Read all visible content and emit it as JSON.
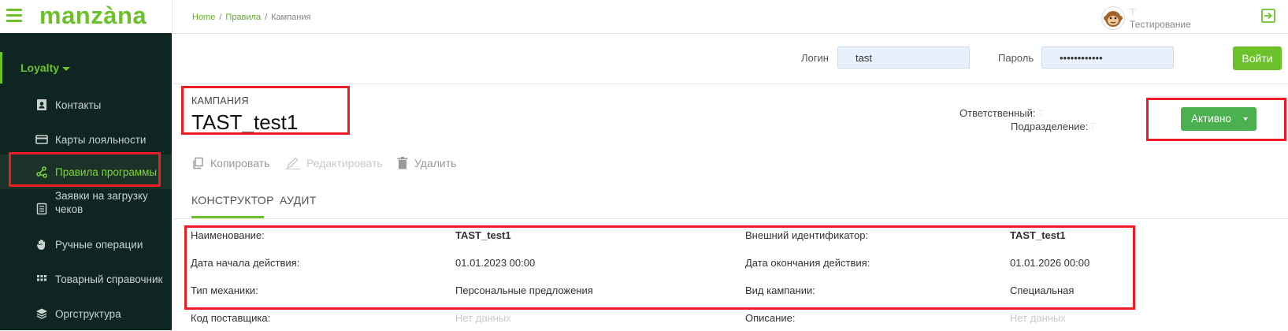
{
  "brand": {
    "logo": "manzàna"
  },
  "sidebar": {
    "section": "Loyalty",
    "items": [
      {
        "label": "Контакты",
        "icon": "contact-card-icon"
      },
      {
        "label": "Карты лояльности",
        "icon": "credit-card-icon"
      },
      {
        "label": "Правила программы",
        "icon": "share-nodes-icon",
        "active": true
      },
      {
        "label": "Заявки на загрузку чеков",
        "icon": "receipt-list-icon"
      },
      {
        "label": "Ручные операции",
        "icon": "hand-icon"
      },
      {
        "label": "Товарный справочник",
        "icon": "grid-icon"
      },
      {
        "label": "Оргструктура",
        "icon": "layers-icon"
      }
    ]
  },
  "breadcrumb": {
    "home": "Home",
    "rules": "Правила",
    "current": "Кампания",
    "sep": "/"
  },
  "user": {
    "name": "Т",
    "org": "Тестирование"
  },
  "login": {
    "login_label": "Логин",
    "login_value": "tast",
    "password_label": "Пароль",
    "password_value": "••••••••••••",
    "submit_label": "Войти"
  },
  "campaign": {
    "kicker": "КАМПАНИЯ",
    "title": "TAST_test1",
    "responsible_label": "Ответственный:",
    "responsible_value": "Т",
    "department_label": "Подразделение:",
    "department_value": "Т",
    "status_label": "Активно"
  },
  "actions": {
    "copy": "Копировать",
    "edit": "Редактировать",
    "delete": "Удалить"
  },
  "tabs": {
    "constructor": "КОНСТРУКТОР",
    "audit": "АУДИТ"
  },
  "details": {
    "name_label": "Наименование:",
    "name_value": "TAST_test1",
    "ext_id_label": "Внешний идентификатор:",
    "ext_id_value": "TAST_test1",
    "start_label": "Дата начала действия:",
    "start_value": "01.01.2023 00:00",
    "end_label": "Дата окончания действия:",
    "end_value": "01.01.2026 00:00",
    "mechanics_label": "Тип механики:",
    "mechanics_value": "Персональные предложения",
    "kind_label": "Вид кампании:",
    "kind_value": "Специальная",
    "supplier_label": "Код поставщика:",
    "supplier_value": "Нет данных",
    "description_label": "Описание:",
    "description_value": "Нет данных"
  },
  "colors": {
    "accent": "#6cc12b",
    "sidebar_bg": "#0f2522",
    "highlight": "#ee1c25",
    "status": "#4caf50"
  }
}
